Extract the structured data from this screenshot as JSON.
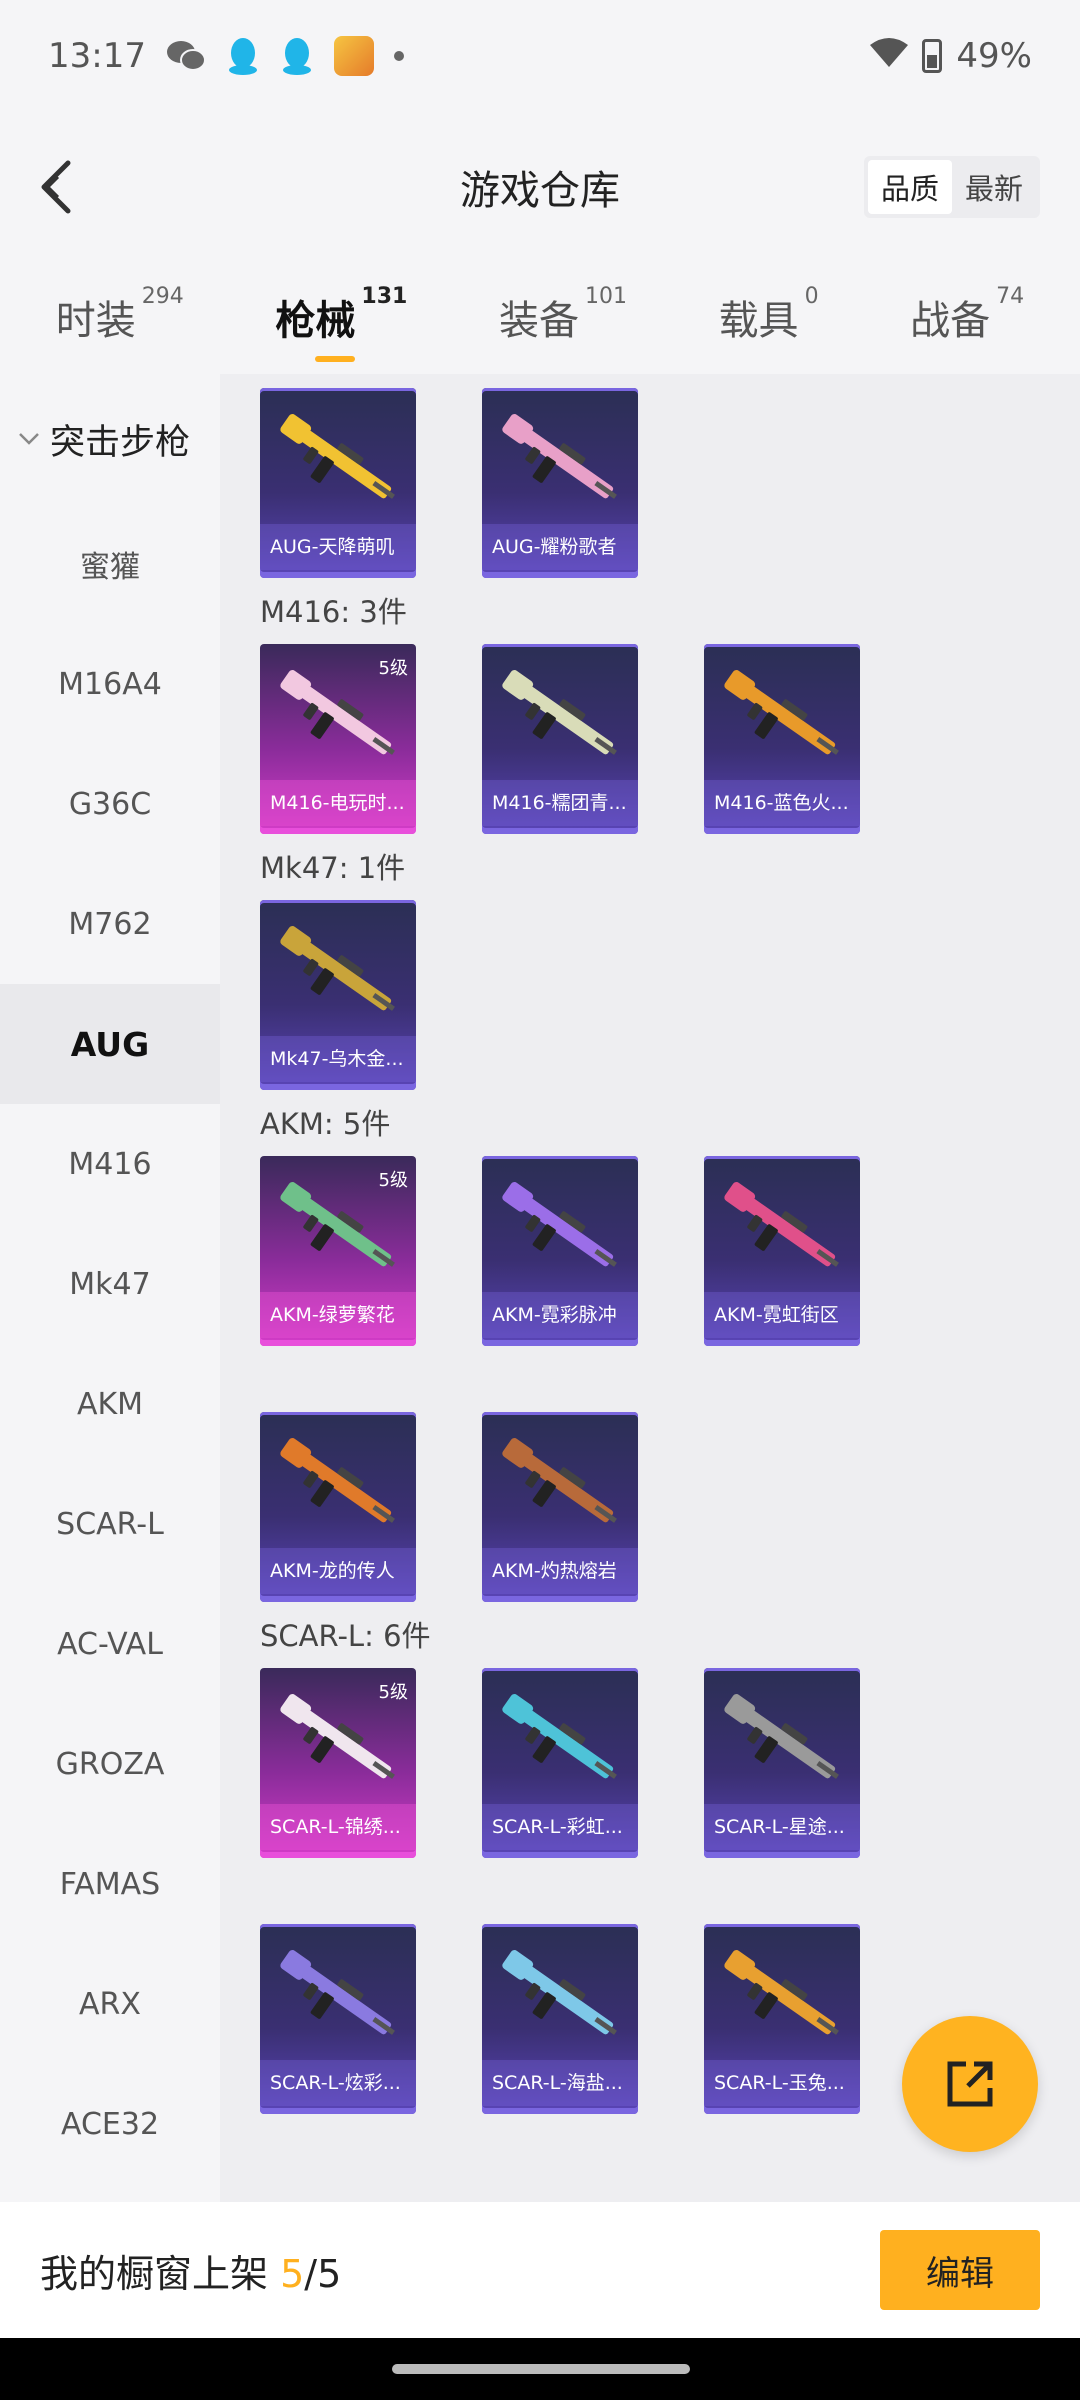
{
  "status_bar": {
    "time": "13:17",
    "battery": "49%"
  },
  "header": {
    "title": "游戏仓库",
    "sort_options": [
      "品质",
      "最新"
    ],
    "active_sort": "品质"
  },
  "tabs": [
    {
      "label": "时装",
      "count": "294"
    },
    {
      "label": "枪械",
      "count": "131"
    },
    {
      "label": "装备",
      "count": "101"
    },
    {
      "label": "载具",
      "count": "0"
    },
    {
      "label": "战备",
      "count": "74"
    }
  ],
  "sidebar": {
    "category": "突击步枪",
    "items": [
      "蜜獾",
      "M16A4",
      "G36C",
      "M762",
      "AUG",
      "M416",
      "Mk47",
      "AKM",
      "SCAR-L",
      "AC-VAL",
      "GROZA",
      "FAMAS",
      "ARX",
      "ACE32"
    ],
    "active": "AUG"
  },
  "groups": [
    {
      "label": "",
      "cards": [
        {
          "name": "AUG-天降萌叽",
          "level": "",
          "rarity": "legendary",
          "gun_color": "#f1c232"
        },
        {
          "name": "AUG-耀粉歌者",
          "level": "",
          "rarity": "legendary",
          "gun_color": "#e8a0c8"
        }
      ]
    },
    {
      "label": "M416: 3件",
      "cards": [
        {
          "name": "M416-电玩时...",
          "level": "5级",
          "rarity": "mythic",
          "gun_color": "#f2c8e0"
        },
        {
          "name": "M416-糯团青...",
          "level": "",
          "rarity": "legendary",
          "gun_color": "#d9dcb8"
        },
        {
          "name": "M416-蓝色火...",
          "level": "",
          "rarity": "legendary",
          "gun_color": "#e89a2a"
        }
      ]
    },
    {
      "label": "Mk47: 1件",
      "cards": [
        {
          "name": "Mk47-乌木金...",
          "level": "",
          "rarity": "legendary",
          "gun_color": "#c9a43a"
        }
      ]
    },
    {
      "label": "AKM: 5件",
      "cards": [
        {
          "name": "AKM-绿萝繁花",
          "level": "5级",
          "rarity": "mythic",
          "gun_color": "#6fc08a"
        },
        {
          "name": "AKM-霓彩脉冲",
          "level": "",
          "rarity": "legendary",
          "gun_color": "#9b6ee8"
        },
        {
          "name": "AKM-霓虹街区",
          "level": "",
          "rarity": "legendary",
          "gun_color": "#e0508a"
        },
        {
          "name": "AKM-龙的传人",
          "level": "",
          "rarity": "legendary",
          "gun_color": "#e07a2a"
        },
        {
          "name": "AKM-灼热熔岩",
          "level": "",
          "rarity": "legendary",
          "gun_color": "#b86a3a"
        }
      ]
    },
    {
      "label": "SCAR-L: 6件",
      "cards": [
        {
          "name": "SCAR-L-锦绣...",
          "level": "5级",
          "rarity": "mythic",
          "gun_color": "#f0e6ee"
        },
        {
          "name": "SCAR-L-彩虹...",
          "level": "",
          "rarity": "legendary",
          "gun_color": "#4ec3d8"
        },
        {
          "name": "SCAR-L-星途...",
          "level": "",
          "rarity": "legendary",
          "gun_color": "#9a9a9a"
        },
        {
          "name": "SCAR-L-炫彩...",
          "level": "",
          "rarity": "legendary",
          "gun_color": "#8a7ae0"
        },
        {
          "name": "SCAR-L-海盐...",
          "level": "",
          "rarity": "legendary",
          "gun_color": "#7ec8e8"
        },
        {
          "name": "SCAR-L-玉兔...",
          "level": "",
          "rarity": "legendary",
          "gun_color": "#e8a030"
        }
      ]
    }
  ],
  "bottom_bar": {
    "text": "我的橱窗上架",
    "current": "5",
    "separator": "/",
    "total": "5",
    "edit_label": "编辑"
  },
  "colors": {
    "accent": "#ffb01f",
    "legendary_card": "#3a2f72",
    "mythic_card": "#d43cc8"
  }
}
